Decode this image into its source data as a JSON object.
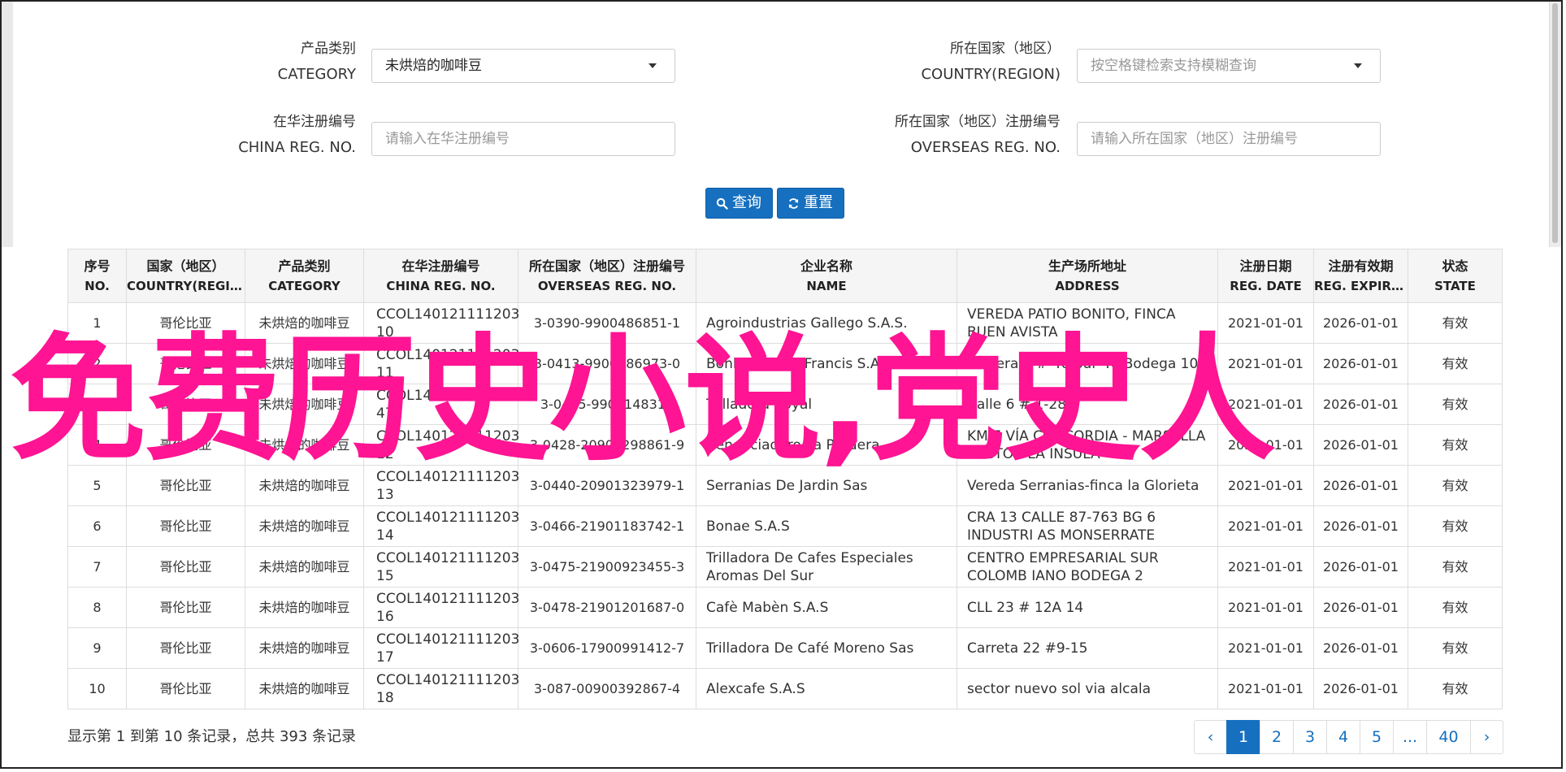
{
  "filters": {
    "category_cn": "产品类别",
    "category_en": "CATEGORY",
    "category_value": "未烘焙的咖啡豆",
    "country_cn": "所在国家（地区）",
    "country_en": "COUNTRY(REGION)",
    "country_placeholder": "按空格键检索支持模糊查询",
    "china_reg_cn": "在华注册编号",
    "china_reg_en": "CHINA REG. NO.",
    "china_reg_placeholder": "请输入在华注册编号",
    "overseas_reg_cn": "所在国家（地区）注册编号",
    "overseas_reg_en": "OVERSEAS REG. NO.",
    "overseas_reg_placeholder": "请输入所在国家（地区）注册编号",
    "search_label": "查询",
    "reset_label": "重置"
  },
  "table": {
    "headers": [
      {
        "cn": "序号",
        "en": "NO."
      },
      {
        "cn": "国家（地区）",
        "en": "COUNTRY(REGIO..."
      },
      {
        "cn": "产品类别",
        "en": "CATEGORY"
      },
      {
        "cn": "在华注册编号",
        "en": "CHINA REG. NO."
      },
      {
        "cn": "所在国家（地区）注册编号",
        "en": "OVERSEAS REG. NO."
      },
      {
        "cn": "企业名称",
        "en": "NAME"
      },
      {
        "cn": "生产场所地址",
        "en": "ADDRESS"
      },
      {
        "cn": "注册日期",
        "en": "REG. DATE"
      },
      {
        "cn": "注册有效期",
        "en": "REG. EXPIRE ..."
      },
      {
        "cn": "状态",
        "en": "STATE"
      }
    ],
    "rows": [
      [
        "1",
        "哥伦比亚",
        "未烘焙的咖啡豆",
        "CCOL140121111203 10",
        "3-0390-9900486851-1",
        "Agroindustrias Gallego S.A.S.",
        "VEREDA PATIO BONITO, FINCA BUEN AVISTA",
        "2021-01-01",
        "2026-01-01",
        "有效"
      ],
      [
        "2",
        "哥伦比亚",
        "未烘焙的咖啡豆",
        "CCOL140121111203 11",
        "3-0413-9900586973-0",
        "Bonbons & St Francis S.A.S",
        "Carrera 4 # 40 Sur 40 Bodega 10 5",
        "2021-01-01",
        "2026-01-01",
        "有效"
      ],
      [
        "3",
        "哥伦比亚",
        "未烘焙的咖啡豆",
        "CCOL140121111203 47",
        "3-0415-9900148311",
        "Trilladora Royal",
        "Calle 6 # 1-28",
        "2021-01-01",
        "2026-01-01",
        "有效"
      ],
      [
        "4",
        "哥伦比亚",
        "未烘焙的咖啡豆",
        "CCOL140121111203 12",
        "3-0428-20900298861-9",
        "Beneficiadero La Pradera",
        "KM 7 VÍA CONCORDIA - MARSELLA SECTOR LA INSULA",
        "2021-01-01",
        "2026-01-01",
        "有效"
      ],
      [
        "5",
        "哥伦比亚",
        "未烘焙的咖啡豆",
        "CCOL140121111203 13",
        "3-0440-20901323979-1",
        "Serranias De Jardin Sas",
        "Vereda Serranias-finca la Glorieta",
        "2021-01-01",
        "2026-01-01",
        "有效"
      ],
      [
        "6",
        "哥伦比亚",
        "未烘焙的咖啡豆",
        "CCOL140121111203 14",
        "3-0466-21901183742-1",
        "Bonae S.A.S",
        "CRA 13 CALLE 87-763 BG 6 INDUSTRI AS MONSERRATE",
        "2021-01-01",
        "2026-01-01",
        "有效"
      ],
      [
        "7",
        "哥伦比亚",
        "未烘焙的咖啡豆",
        "CCOL140121111203 15",
        "3-0475-21900923455-3",
        "Trilladora De Cafes Especiales Aromas Del Sur",
        "CENTRO EMPRESARIAL SUR COLOMB IANO BODEGA 2",
        "2021-01-01",
        "2026-01-01",
        "有效"
      ],
      [
        "8",
        "哥伦比亚",
        "未烘焙的咖啡豆",
        "CCOL140121111203 16",
        "3-0478-21901201687-0",
        "Cafè Mabèn S.A.S",
        "CLL 23 # 12A 14",
        "2021-01-01",
        "2026-01-01",
        "有效"
      ],
      [
        "9",
        "哥伦比亚",
        "未烘焙的咖啡豆",
        "CCOL140121111203 17",
        "3-0606-17900991412-7",
        "Trilladora De Café Moreno Sas",
        "Carreta 22 #9-15",
        "2021-01-01",
        "2026-01-01",
        "有效"
      ],
      [
        "10",
        "哥伦比亚",
        "未烘焙的咖啡豆",
        "CCOL140121111203 18",
        "3-087-00900392867-4",
        "Alexcafe S.A.S",
        "sector nuevo sol via alcala",
        "2021-01-01",
        "2026-01-01",
        "有效"
      ]
    ]
  },
  "pagination": {
    "summary": "显示第 1 到第 10 条记录，总共 393 条记录",
    "prev": "‹",
    "pages": [
      "1",
      "2",
      "3",
      "4",
      "5",
      "...",
      "40"
    ],
    "next": "›"
  },
  "overlay_text": "免费历史小说,党史人",
  "colors": {
    "primary": "#1670bf",
    "overlay": "#ff1493"
  }
}
